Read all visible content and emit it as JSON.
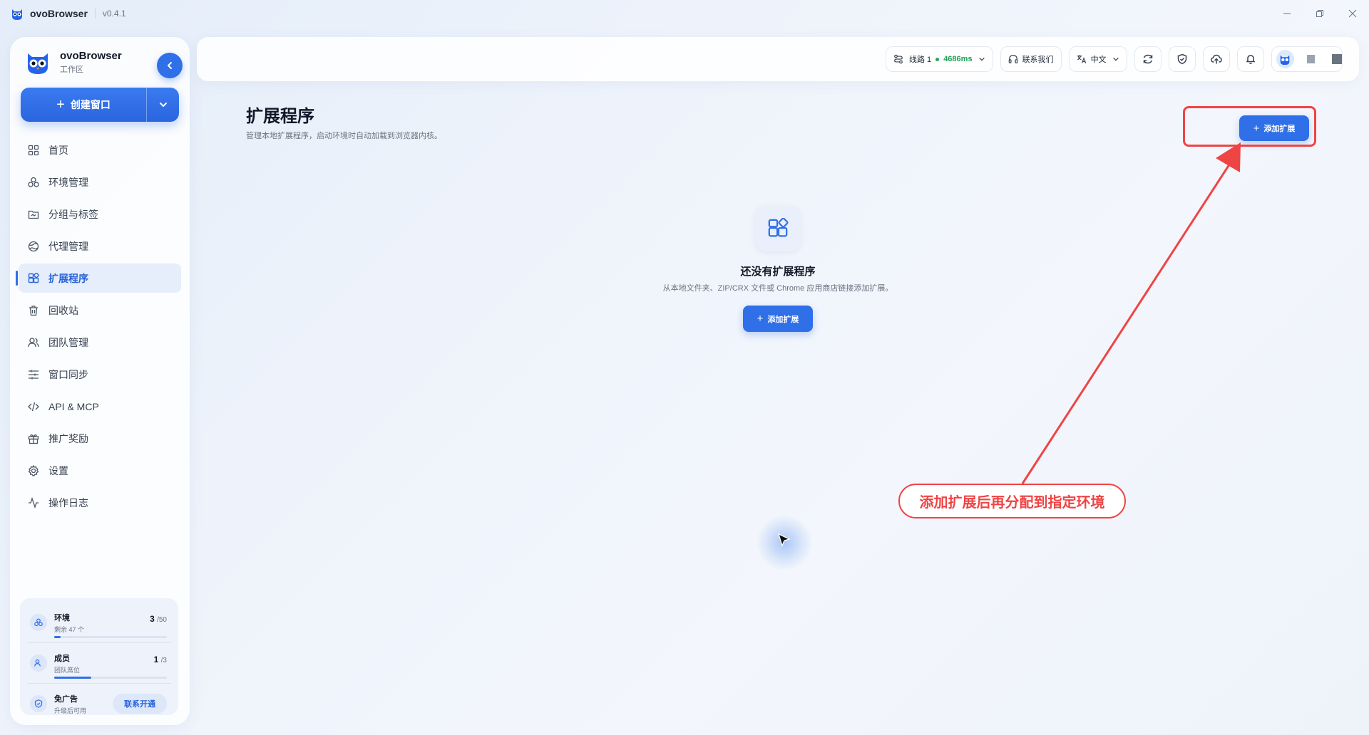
{
  "titlebar": {
    "app_name": "ovoBrowser",
    "version": "v0.4.1"
  },
  "sidebar": {
    "brand_name": "ovoBrowser",
    "brand_sub": "工作区",
    "create_label": "创建窗口",
    "items": [
      {
        "label": "首页",
        "icon": "grid-icon"
      },
      {
        "label": "环境管理",
        "icon": "cluster-icon"
      },
      {
        "label": "分组与标签",
        "icon": "folder-icon"
      },
      {
        "label": "代理管理",
        "icon": "globe-icon"
      },
      {
        "label": "扩展程序",
        "icon": "puzzle-icon",
        "active": true
      },
      {
        "label": "回收站",
        "icon": "trash-icon"
      },
      {
        "label": "团队管理",
        "icon": "users-icon"
      },
      {
        "label": "窗口同步",
        "icon": "sliders-icon"
      },
      {
        "label": "API & MCP",
        "icon": "code-icon"
      },
      {
        "label": "推广奖励",
        "icon": "gift-icon"
      },
      {
        "label": "设置",
        "icon": "gear-icon"
      },
      {
        "label": "操作日志",
        "icon": "activity-icon"
      }
    ],
    "usage": {
      "env_title": "环境",
      "env_sub": "剩余 47 个",
      "env_count": "3",
      "env_total": "/50",
      "env_fraction": 0.06,
      "member_title": "成员",
      "member_sub": "团队席位",
      "member_count": "1",
      "member_total": "/3",
      "member_fraction": 0.33,
      "ad_title": "免广告",
      "ad_sub": "升级后可用",
      "contact_label": "联系开通"
    }
  },
  "topbar": {
    "route_label": "线路 1",
    "latency": "4686ms",
    "contact_label": "联系我们",
    "language": "中文"
  },
  "main": {
    "title": "扩展程序",
    "description": "管理本地扩展程序，启动环境时自动加载到浏览器内核。",
    "add_button": "添加扩展",
    "empty_title": "还没有扩展程序",
    "empty_desc": "从本地文件夹、ZIP/CRX 文件或 Chrome 应用商店链接添加扩展。",
    "empty_button": "添加扩展"
  },
  "annotation": {
    "text": "添加扩展后再分配到指定环境",
    "color": "#ef4444"
  },
  "colors": {
    "accent": "#2f6fe8",
    "success": "#1f9d55",
    "annotation": "#ef4444"
  }
}
